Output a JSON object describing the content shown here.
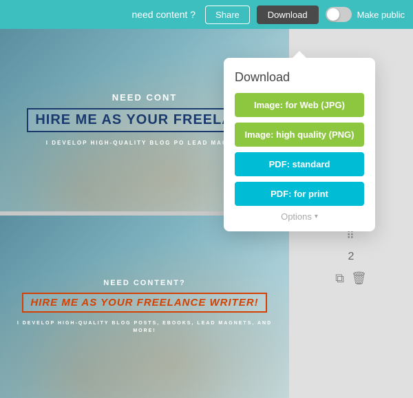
{
  "topbar": {
    "need_content_label": "need content ?",
    "share_label": "Share",
    "download_label": "Download",
    "make_public_label": "Make public"
  },
  "download_popup": {
    "title": "Download",
    "btn_jpg_label": "Image: for Web (JPG)",
    "btn_png_label": "Image: high quality (PNG)",
    "btn_pdf_standard_label": "PDF: standard",
    "btn_pdf_print_label": "PDF: for print",
    "options_label": "Options"
  },
  "card1": {
    "need_content": "NEED CONT",
    "hire_me": "HIRE ME AS YOUR FREELANC",
    "sub": "I DEVELOP HIGH-QUALITY BLOG PO\nLEAD MAGNET"
  },
  "card2": {
    "need_content": "NEED CONTENT?",
    "hire_me": "HIRE ME AS YOUR FREELANCE WRITER!",
    "sub": "I DEVELOP HIGH-QUALITY BLOG POSTS, EBOOKS,\nLEAD MAGNETS, AND MORE!"
  },
  "sidebar": {
    "page_number": "2",
    "copy_icon": "⧉",
    "delete_icon": "🗑"
  }
}
